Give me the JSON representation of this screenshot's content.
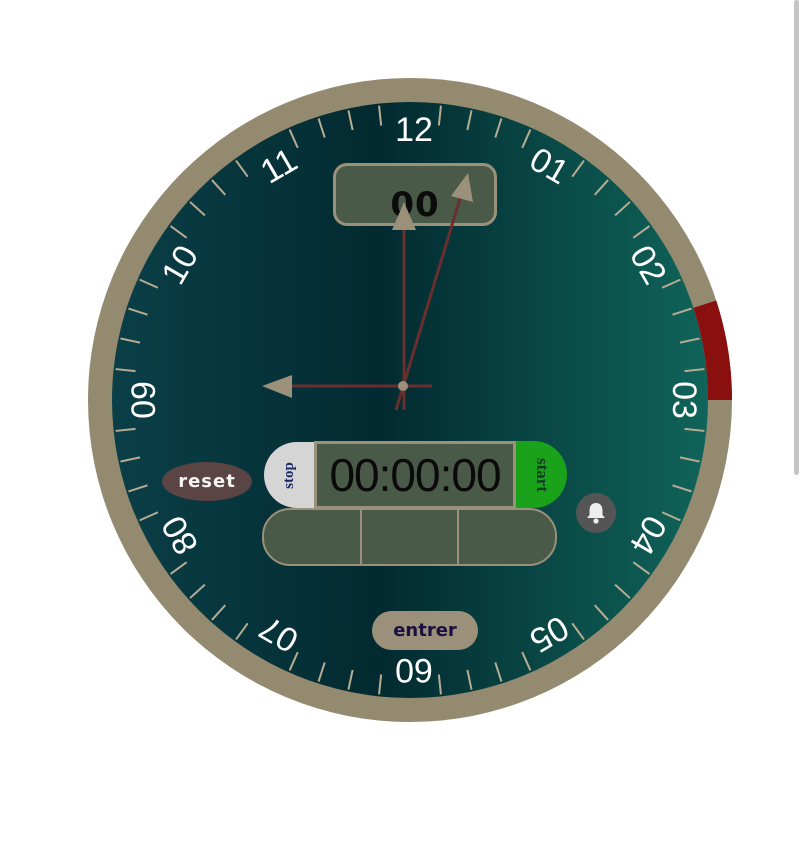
{
  "clock": {
    "hour_labels": [
      {
        "text": "12",
        "angle": 0
      },
      {
        "text": "01",
        "angle": 30
      },
      {
        "text": "02",
        "angle": 60
      },
      {
        "text": "03",
        "angle": 90
      },
      {
        "text": "04",
        "angle": 120
      },
      {
        "text": "05",
        "angle": 150
      },
      {
        "text": "60",
        "angle": 180
      },
      {
        "text": "07",
        "angle": 210
      },
      {
        "text": "80",
        "angle": 240
      },
      {
        "text": "09",
        "angle": 270
      },
      {
        "text": "10",
        "angle": 300
      },
      {
        "text": "11",
        "angle": 330
      }
    ],
    "digital_value": "00",
    "colors": {
      "bezel": "#948a6f",
      "face_dark": "#022a30",
      "face_light": "#10645a",
      "hand": "#6b2e2e",
      "arrow": "#9b907a",
      "alarm_arc": "#8a1010"
    }
  },
  "timer": {
    "display": "00:00:00",
    "stop_label": "stop",
    "start_label": "start",
    "reset_label": "reset",
    "enter_label": "entrer",
    "bell_icon": "bell-icon",
    "inputs": [
      "",
      "",
      ""
    ]
  }
}
